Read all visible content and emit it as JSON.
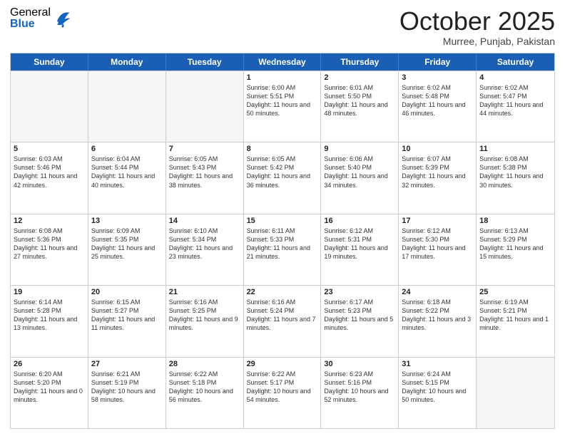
{
  "header": {
    "logo_general": "General",
    "logo_blue": "Blue",
    "month_title": "October 2025",
    "location": "Murree, Punjab, Pakistan"
  },
  "days_of_week": [
    "Sunday",
    "Monday",
    "Tuesday",
    "Wednesday",
    "Thursday",
    "Friday",
    "Saturday"
  ],
  "weeks": [
    [
      {
        "date": "",
        "info": ""
      },
      {
        "date": "",
        "info": ""
      },
      {
        "date": "",
        "info": ""
      },
      {
        "date": "1",
        "sunrise": "Sunrise: 6:00 AM",
        "sunset": "Sunset: 5:51 PM",
        "daylight": "Daylight: 11 hours and 50 minutes."
      },
      {
        "date": "2",
        "sunrise": "Sunrise: 6:01 AM",
        "sunset": "Sunset: 5:50 PM",
        "daylight": "Daylight: 11 hours and 48 minutes."
      },
      {
        "date": "3",
        "sunrise": "Sunrise: 6:02 AM",
        "sunset": "Sunset: 5:48 PM",
        "daylight": "Daylight: 11 hours and 46 minutes."
      },
      {
        "date": "4",
        "sunrise": "Sunrise: 6:02 AM",
        "sunset": "Sunset: 5:47 PM",
        "daylight": "Daylight: 11 hours and 44 minutes."
      }
    ],
    [
      {
        "date": "5",
        "sunrise": "Sunrise: 6:03 AM",
        "sunset": "Sunset: 5:46 PM",
        "daylight": "Daylight: 11 hours and 42 minutes."
      },
      {
        "date": "6",
        "sunrise": "Sunrise: 6:04 AM",
        "sunset": "Sunset: 5:44 PM",
        "daylight": "Daylight: 11 hours and 40 minutes."
      },
      {
        "date": "7",
        "sunrise": "Sunrise: 6:05 AM",
        "sunset": "Sunset: 5:43 PM",
        "daylight": "Daylight: 11 hours and 38 minutes."
      },
      {
        "date": "8",
        "sunrise": "Sunrise: 6:05 AM",
        "sunset": "Sunset: 5:42 PM",
        "daylight": "Daylight: 11 hours and 36 minutes."
      },
      {
        "date": "9",
        "sunrise": "Sunrise: 6:06 AM",
        "sunset": "Sunset: 5:40 PM",
        "daylight": "Daylight: 11 hours and 34 minutes."
      },
      {
        "date": "10",
        "sunrise": "Sunrise: 6:07 AM",
        "sunset": "Sunset: 5:39 PM",
        "daylight": "Daylight: 11 hours and 32 minutes."
      },
      {
        "date": "11",
        "sunrise": "Sunrise: 6:08 AM",
        "sunset": "Sunset: 5:38 PM",
        "daylight": "Daylight: 11 hours and 30 minutes."
      }
    ],
    [
      {
        "date": "12",
        "sunrise": "Sunrise: 6:08 AM",
        "sunset": "Sunset: 5:36 PM",
        "daylight": "Daylight: 11 hours and 27 minutes."
      },
      {
        "date": "13",
        "sunrise": "Sunrise: 6:09 AM",
        "sunset": "Sunset: 5:35 PM",
        "daylight": "Daylight: 11 hours and 25 minutes."
      },
      {
        "date": "14",
        "sunrise": "Sunrise: 6:10 AM",
        "sunset": "Sunset: 5:34 PM",
        "daylight": "Daylight: 11 hours and 23 minutes."
      },
      {
        "date": "15",
        "sunrise": "Sunrise: 6:11 AM",
        "sunset": "Sunset: 5:33 PM",
        "daylight": "Daylight: 11 hours and 21 minutes."
      },
      {
        "date": "16",
        "sunrise": "Sunrise: 6:12 AM",
        "sunset": "Sunset: 5:31 PM",
        "daylight": "Daylight: 11 hours and 19 minutes."
      },
      {
        "date": "17",
        "sunrise": "Sunrise: 6:12 AM",
        "sunset": "Sunset: 5:30 PM",
        "daylight": "Daylight: 11 hours and 17 minutes."
      },
      {
        "date": "18",
        "sunrise": "Sunrise: 6:13 AM",
        "sunset": "Sunset: 5:29 PM",
        "daylight": "Daylight: 11 hours and 15 minutes."
      }
    ],
    [
      {
        "date": "19",
        "sunrise": "Sunrise: 6:14 AM",
        "sunset": "Sunset: 5:28 PM",
        "daylight": "Daylight: 11 hours and 13 minutes."
      },
      {
        "date": "20",
        "sunrise": "Sunrise: 6:15 AM",
        "sunset": "Sunset: 5:27 PM",
        "daylight": "Daylight: 11 hours and 11 minutes."
      },
      {
        "date": "21",
        "sunrise": "Sunrise: 6:16 AM",
        "sunset": "Sunset: 5:25 PM",
        "daylight": "Daylight: 11 hours and 9 minutes."
      },
      {
        "date": "22",
        "sunrise": "Sunrise: 6:16 AM",
        "sunset": "Sunset: 5:24 PM",
        "daylight": "Daylight: 11 hours and 7 minutes."
      },
      {
        "date": "23",
        "sunrise": "Sunrise: 6:17 AM",
        "sunset": "Sunset: 5:23 PM",
        "daylight": "Daylight: 11 hours and 5 minutes."
      },
      {
        "date": "24",
        "sunrise": "Sunrise: 6:18 AM",
        "sunset": "Sunset: 5:22 PM",
        "daylight": "Daylight: 11 hours and 3 minutes."
      },
      {
        "date": "25",
        "sunrise": "Sunrise: 6:19 AM",
        "sunset": "Sunset: 5:21 PM",
        "daylight": "Daylight: 11 hours and 1 minute."
      }
    ],
    [
      {
        "date": "26",
        "sunrise": "Sunrise: 6:20 AM",
        "sunset": "Sunset: 5:20 PM",
        "daylight": "Daylight: 11 hours and 0 minutes."
      },
      {
        "date": "27",
        "sunrise": "Sunrise: 6:21 AM",
        "sunset": "Sunset: 5:19 PM",
        "daylight": "Daylight: 10 hours and 58 minutes."
      },
      {
        "date": "28",
        "sunrise": "Sunrise: 6:22 AM",
        "sunset": "Sunset: 5:18 PM",
        "daylight": "Daylight: 10 hours and 56 minutes."
      },
      {
        "date": "29",
        "sunrise": "Sunrise: 6:22 AM",
        "sunset": "Sunset: 5:17 PM",
        "daylight": "Daylight: 10 hours and 54 minutes."
      },
      {
        "date": "30",
        "sunrise": "Sunrise: 6:23 AM",
        "sunset": "Sunset: 5:16 PM",
        "daylight": "Daylight: 10 hours and 52 minutes."
      },
      {
        "date": "31",
        "sunrise": "Sunrise: 6:24 AM",
        "sunset": "Sunset: 5:15 PM",
        "daylight": "Daylight: 10 hours and 50 minutes."
      },
      {
        "date": "",
        "info": ""
      }
    ]
  ]
}
